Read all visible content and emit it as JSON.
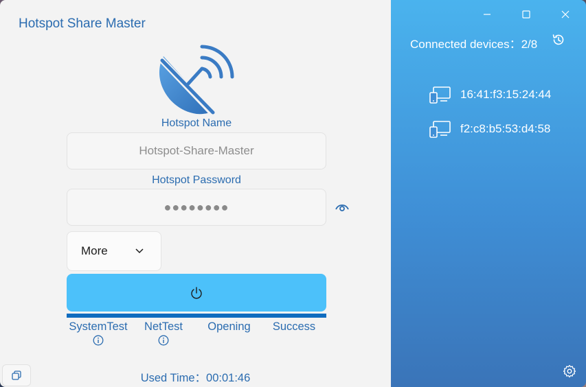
{
  "app": {
    "title": "Hotspot Share Master"
  },
  "form": {
    "name_label": "Hotspot Name",
    "name_placeholder": "Hotspot-Share-Master",
    "password_label": "Hotspot Password",
    "password_value": "●●●●●●●●",
    "more_label": "More"
  },
  "steps": [
    {
      "label": "SystemTest",
      "has_info": true
    },
    {
      "label": "NetTest",
      "has_info": true
    },
    {
      "label": "Opening",
      "has_info": false
    },
    {
      "label": "Success",
      "has_info": false
    }
  ],
  "progress": 1.0,
  "status": {
    "used_time": "Used Time：00:01:46"
  },
  "devices_panel": {
    "connected_text": "Connected devices：2/8",
    "devices": [
      {
        "mac": "16:41:f3:15:24:44"
      },
      {
        "mac": "f2:c8:b5:53:d4:58"
      }
    ]
  },
  "icons": {
    "logo": "satellite-dish-icon",
    "eye": "eye-icon",
    "chevron": "chevron-down-icon",
    "power": "power-icon",
    "info": "info-icon",
    "history": "history-icon",
    "device": "devices-icon",
    "settings": "gear-icon",
    "restore": "copy-icon"
  },
  "colors": {
    "accent": "#2b6cb0",
    "button": "#4cc1fa",
    "progress": "#0f6cbf",
    "panel_top": "#4ab3ee",
    "panel_bottom": "#3a74b8"
  }
}
